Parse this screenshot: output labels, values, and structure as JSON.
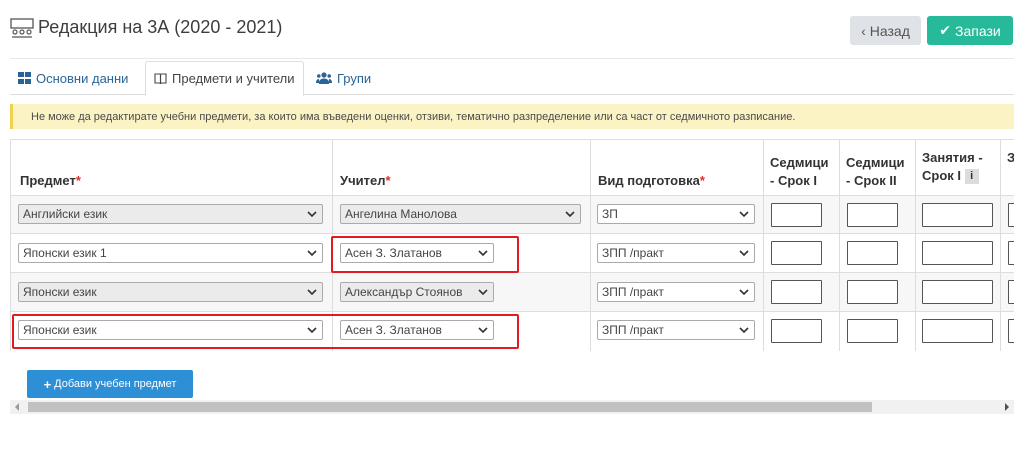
{
  "header": {
    "title": "Редакция на 3А (2020 - 2021)",
    "back_label": "Назад",
    "save_label": "Запази"
  },
  "tabs": [
    {
      "label": "Основни данни",
      "icon": "grid-icon"
    },
    {
      "label": "Предмети и учители",
      "icon": "book-icon",
      "active": true
    },
    {
      "label": "Групи",
      "icon": "users-icon"
    }
  ],
  "alert": {
    "text": "Не може да редактирате учебни предмети, за които има въведени оценки, отзиви, тематично разпределение или са част от седмичното разписание."
  },
  "table": {
    "headers": {
      "subject": "Предмет",
      "teacher": "Учител",
      "prep": "Вид подготовка",
      "weekly1": "Седмици - Срок I",
      "weekly2": "Седмици - Срок II",
      "lessons": "Занятия - Срок I",
      "partial": "З"
    },
    "required_mark": "*",
    "rows": [
      {
        "subject": "Английски език",
        "teacher": "Ангелина Манолова",
        "prep": "ЗП"
      },
      {
        "subject": "Японски език 1",
        "teacher": "Асен З. Златанов",
        "prep": "ЗПП /практ"
      },
      {
        "subject": "Японски език",
        "teacher": "Александър Стоянов",
        "prep": "ЗПП /практ"
      },
      {
        "subject": "Японски език",
        "teacher": "Асен З. Златанов",
        "prep": "ЗПП /практ"
      }
    ]
  },
  "add_button_label": "Добави учебен предмет",
  "colors": {
    "save": "#26b99a",
    "add": "#2d8fd5",
    "highlight": "#e21b23",
    "alert_bg": "#fcf3c5"
  }
}
